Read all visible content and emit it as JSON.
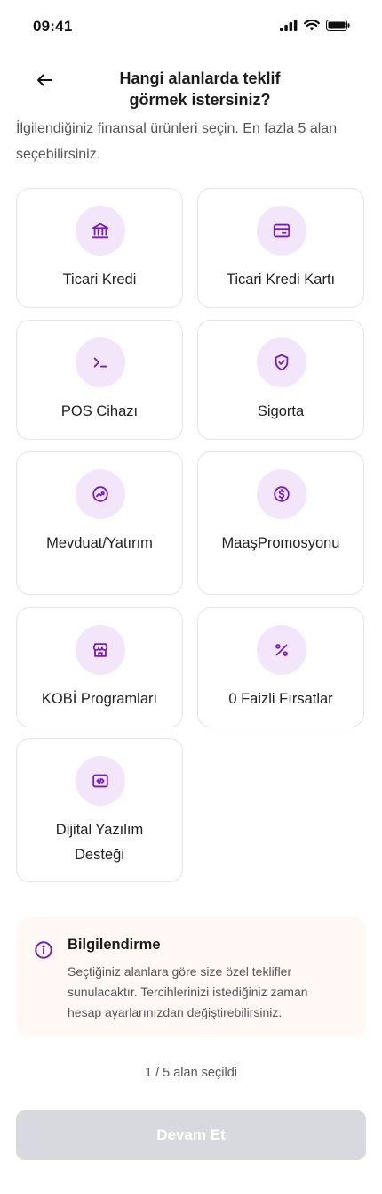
{
  "status_bar": {
    "time": "09:41"
  },
  "header": {
    "back_icon": "arrow-left-icon",
    "title_line1": "Hangi alanlarda teklif",
    "title_line2": "görmek istersiniz?"
  },
  "subtitle": "İlgilendiğiniz finansal ürünleri seçin. En fazla 5 alan seçebilirsiniz.",
  "accent_color": "#7a1fb3",
  "icon_bg_color": "#f3e6fb",
  "categories": [
    {
      "label": "Ticari Kredi",
      "icon": "bank-icon"
    },
    {
      "label": "Ticari Kredi Kartı",
      "icon": "credit-card-icon"
    },
    {
      "label": "POS Cihazı",
      "icon": "terminal-icon"
    },
    {
      "label": "Sigorta",
      "icon": "shield-check-icon"
    },
    {
      "label": "Mevduat/Yatırım",
      "icon": "trend-up-icon"
    },
    {
      "label": "MaaşPromosyonu",
      "icon": "dollar-coin-icon"
    },
    {
      "label": "KOBİ Programları",
      "icon": "storefront-icon"
    },
    {
      "label": "0 Faizli Fırsatlar",
      "icon": "percent-icon"
    },
    {
      "label_line1": "Dijital Yazılım",
      "label_line2": "Desteği",
      "icon": "code-window-icon"
    }
  ],
  "info": {
    "icon": "info-icon",
    "title": "Bilgilendirme",
    "text": "Seçtiğiniz alanlara göre size özel teklifler sunulacaktır. Tercihlerinizi istediğiniz zaman hesap ayarlarınızdan değiştirebilirsiniz."
  },
  "counter": "1 / 5 alan seçildi",
  "continue_label": "Devam Et"
}
